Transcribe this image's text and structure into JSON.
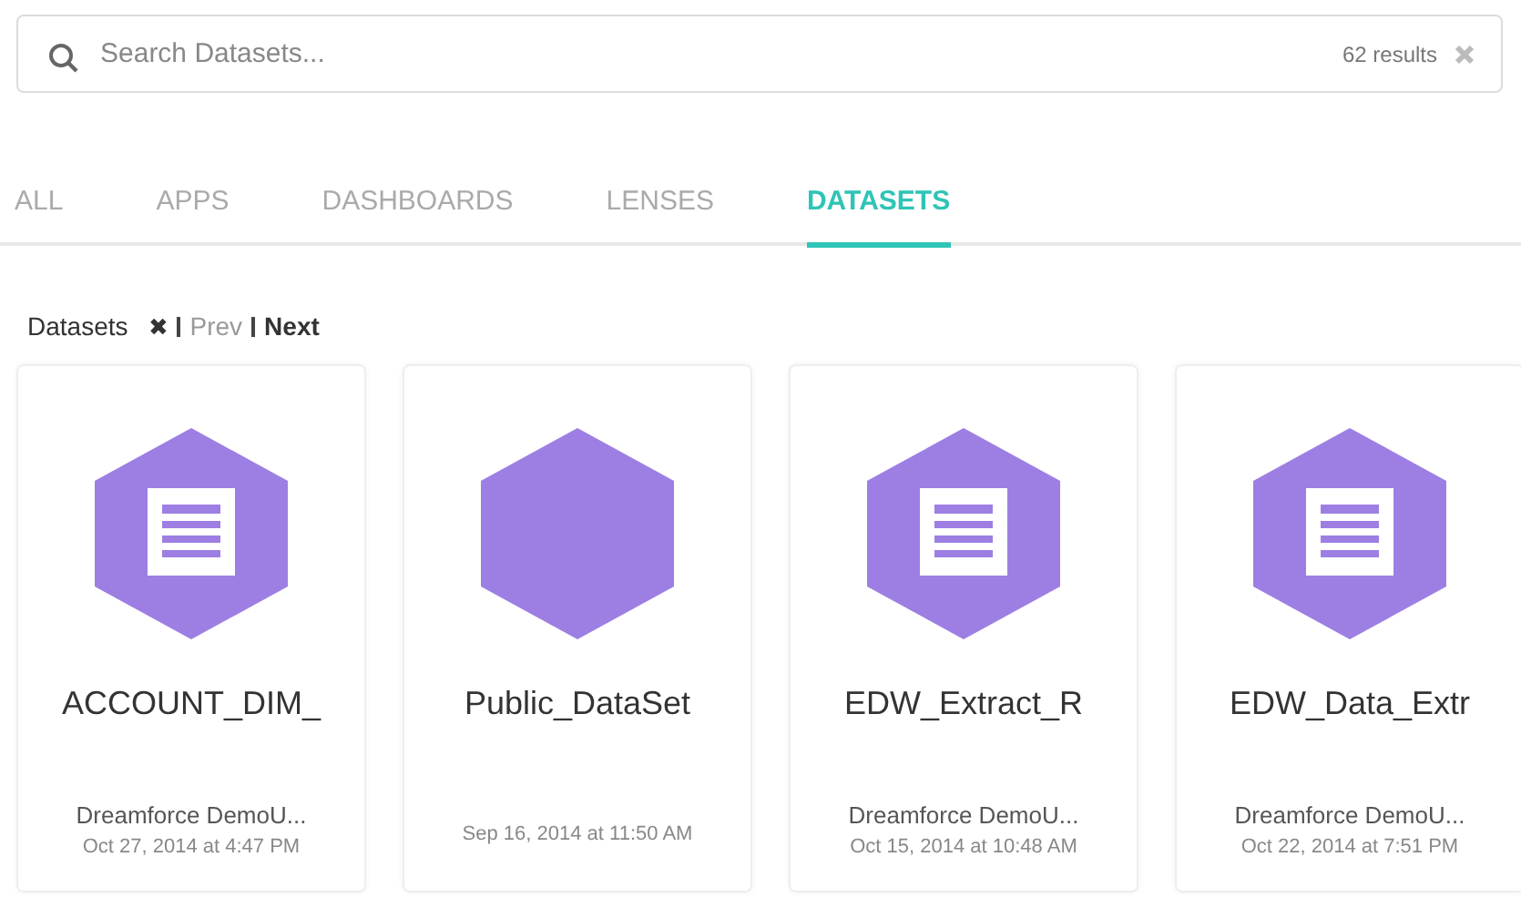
{
  "search": {
    "placeholder": "Search Datasets...",
    "result_count": "62 results"
  },
  "tabs": [
    {
      "label": "ALL",
      "selected": false
    },
    {
      "label": "APPS",
      "selected": false
    },
    {
      "label": "DASHBOARDS",
      "selected": false
    },
    {
      "label": "LENSES",
      "selected": false
    },
    {
      "label": "DATASETS",
      "selected": true
    }
  ],
  "breadcrumb": {
    "label": "Datasets",
    "close": "✖",
    "prev": "Prev",
    "next": "Next"
  },
  "cards": [
    {
      "title": "ACCOUNT_DIM_",
      "owner": "Dreamforce DemoU...",
      "date": "Oct 27, 2014 at 4:47 PM",
      "kind": "document"
    },
    {
      "title": "Public_DataSet",
      "date": "Sep 16, 2014 at 11:50 AM",
      "kind": "blank"
    },
    {
      "title": "EDW_Extract_R",
      "owner": "Dreamforce DemoU...",
      "date": "Oct 15, 2014 at 10:48 AM",
      "kind": "document"
    },
    {
      "title": "EDW_Data_Extr",
      "owner": "Dreamforce DemoU...",
      "date": "Oct 22, 2014 at 7:51 PM",
      "kind": "document"
    }
  ]
}
